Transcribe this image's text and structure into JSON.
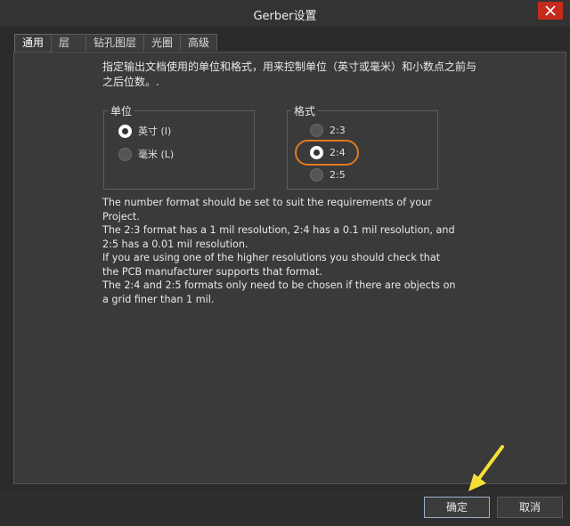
{
  "window": {
    "title": "Gerber设置"
  },
  "tabs": [
    {
      "label": "通用",
      "active": true
    },
    {
      "label": "层",
      "active": false
    },
    {
      "label": "钻孔图层",
      "active": false
    },
    {
      "label": "光圈",
      "active": false
    },
    {
      "label": "高级",
      "active": false
    }
  ],
  "description": "指定输出文档使用的单位和格式，用来控制单位（英寸或毫米）和小数点之前与之后位数。.",
  "units_group": {
    "label": "单位",
    "options": [
      {
        "label": "英寸 (I)",
        "checked": true
      },
      {
        "label": "毫米 (L)",
        "checked": false
      }
    ]
  },
  "format_group": {
    "label": "格式",
    "options": [
      {
        "label": "2:3",
        "checked": false
      },
      {
        "label": "2:4",
        "checked": true
      },
      {
        "label": "2:5",
        "checked": false
      }
    ]
  },
  "info_text": "The number format should be set to suit the requirements of your Project.\nThe 2:3 format has a 1 mil resolution, 2:4 has a 0.1 mil resolution, and 2:5 has a 0.01 mil resolution.\nIf you are using one of the higher resolutions you should check that the PCB manufacturer supports that format.\nThe 2:4 and 2:5 formats only need to be chosen if there are objects on a grid finer than 1 mil.",
  "footer": {
    "ok_label": "确定",
    "cancel_label": "取消"
  },
  "colors": {
    "highlight": "#e07b1e",
    "arrow": "#f5e03a",
    "close": "#c42b1c"
  }
}
